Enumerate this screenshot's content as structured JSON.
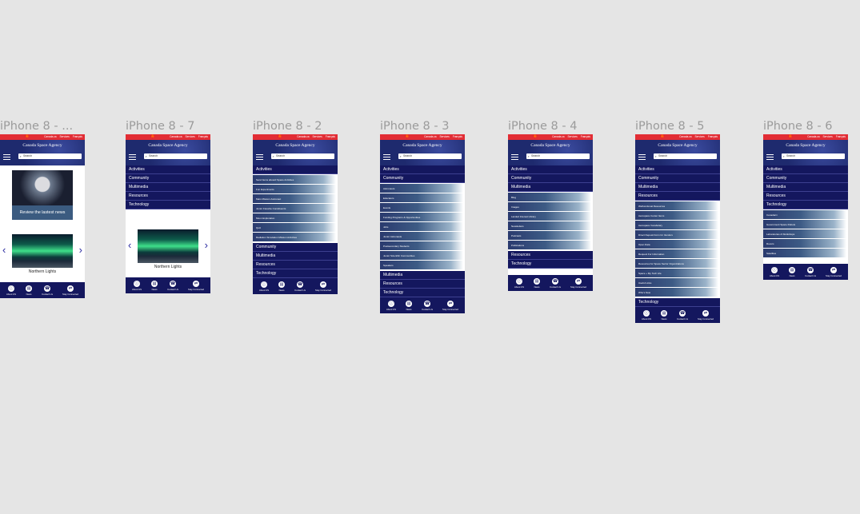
{
  "frames": [
    {
      "title": "iPhone 8 - ..."
    },
    {
      "title": "iPhone 8 - 7"
    },
    {
      "title": "iPhone 8 - 2"
    },
    {
      "title": "iPhone 8 - 3"
    },
    {
      "title": "iPhone 8 - 4"
    },
    {
      "title": "iPhone 8 - 5"
    },
    {
      "title": "iPhone 8 - 6"
    }
  ],
  "common": {
    "agency": "Canada Space Agency",
    "top_links": [
      "Canada.ca",
      "Services",
      "Français"
    ],
    "search_placeholder": "Search",
    "menu": [
      "Activities",
      "Community",
      "Multimedia",
      "Resources",
      "Technology"
    ],
    "footer": [
      {
        "label": "About US",
        "icon": "info-icon"
      },
      {
        "label": "News",
        "icon": "news-icon"
      },
      {
        "label": "Contact Us",
        "icon": "phone-icon"
      },
      {
        "label": "Stay Connected",
        "icon": "share-icon"
      }
    ]
  },
  "home": {
    "news_label": "Review the lastest news",
    "carousel_caption": "Northern Lights"
  },
  "submenus": {
    "activities": [
      "Send Items aboard Space Activities",
      "Fun Experiments",
      "Mars Mission Astronaut",
      "Junior Favorite Constituents",
      "Moon Exploration",
      "Quiz",
      "Radiation Simulation Mission Activities"
    ],
    "community": [
      "Astronauts",
      "Educators",
      "Events",
      "Funding Programs & Opportunities",
      "Jobs",
      "Junior Astronauts",
      "Postsecondary Students",
      "Junior Scientific Communities",
      "Speakers"
    ],
    "multimedia": [
      "Blog",
      "Images",
      "Landed Interest Library",
      "Newsletters",
      "Podcasts",
      "Publications"
    ],
    "resources": [
      "Welfunctional Resources",
      "Aerospace Center Items",
      "Aerospace Vocabulary",
      "Direct Deposit Form for Vendors",
      "Open Data",
      "Request For Information",
      "Resources for Space Sector Organizations",
      "Space + My Tech Life",
      "Useful Links",
      "Who's New"
    ],
    "technology": [
      "Canadarm",
      "Government Space Robots",
      "Laboratories & Workshops",
      "Rovers",
      "Satellites"
    ]
  }
}
